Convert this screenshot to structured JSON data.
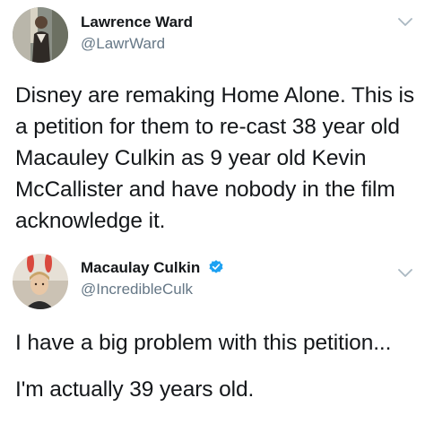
{
  "tweets": [
    {
      "display_name": "Lawrence Ward",
      "handle": "@LawrWard",
      "verified": false,
      "paragraphs": [
        "Disney are remaking Home Alone. This is a petition for them to re-cast 38 year old Macauley Culkin as 9 year old Kevin McCallister and have nobody in the film acknowledge it."
      ]
    },
    {
      "display_name": "Macaulay Culkin",
      "handle": "@IncredibleCulk",
      "verified": true,
      "paragraphs": [
        "I have a big problem with this petition...",
        "I'm actually 39 years old."
      ]
    }
  ],
  "colors": {
    "text": "#14171a",
    "handle": "#657786",
    "verified": "#1da1f2",
    "chevron": "#aab8c2"
  },
  "icons": [
    "avatar",
    "verified-badge-icon",
    "chevron-down-icon"
  ]
}
